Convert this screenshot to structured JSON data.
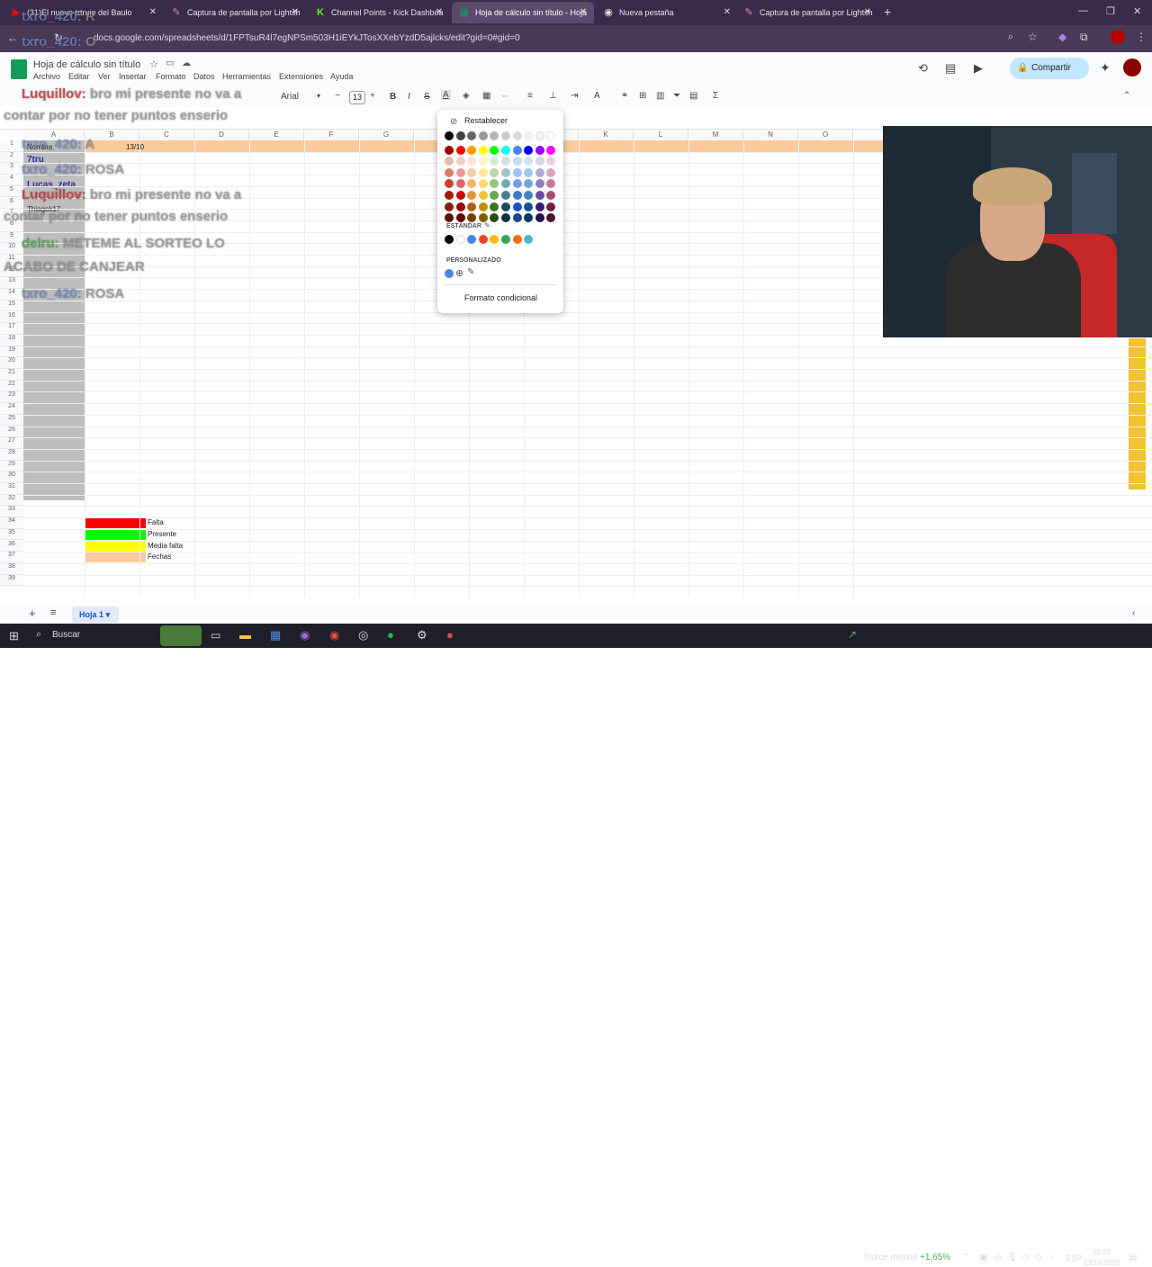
{
  "browser_tabs": [
    {
      "title": "(31)El nuevo trtruie del Baulo",
      "icon": "youtube-icon"
    },
    {
      "title": "Captura de pantalla por Lightsh",
      "icon": "feather-icon"
    },
    {
      "title": "Channel Points - Kick Dashboa",
      "icon": "kick-icon"
    },
    {
      "title": "Hoja de cálculo sin título - Hoja",
      "icon": "sheets-icon",
      "active": true
    },
    {
      "title": "Nueva pestaña",
      "icon": "chrome-icon"
    },
    {
      "title": "Captura de pantalla por Lightsh",
      "icon": "feather-icon"
    }
  ],
  "url": "docs.google.com/spreadsheets/d/1FPTsuR4l7egNPSm503H1iEYkJTosXXebYzdD5ajlcks/edit?gid=0#gid=0",
  "doc": {
    "title": "Hoja de cálculo sin título",
    "share_label": "Compartir"
  },
  "menu": [
    "Archivo",
    "Editar",
    "Ver",
    "Insertar",
    "Formato",
    "Datos",
    "Herramientas",
    "Extensiones",
    "Ayuda"
  ],
  "toolbar": {
    "font": "Arial",
    "font_size": "13"
  },
  "columns": [
    "A",
    "B",
    "C",
    "D",
    "E",
    "F",
    "G",
    "H",
    "I",
    "J",
    "K",
    "L",
    "M",
    "N",
    "O"
  ],
  "cells": {
    "b1": "13/10",
    "a1": "Nombre",
    "a6": "Thiagok17",
    "a5": "Lucas_zeta",
    "a2": "7tru"
  },
  "legend": [
    {
      "label": "Falta",
      "color": "#ff0000"
    },
    {
      "label": "Presente",
      "color": "#00ff00"
    },
    {
      "label": "Media falta",
      "color": "#ffff00"
    },
    {
      "label": "Fechas",
      "color": "#f9cb9c"
    }
  ],
  "palette": {
    "reset_label": "Restablecer",
    "standard_label": "ESTÁNDAR",
    "custom_label": "PERSONALIZADO",
    "cond_label": "Formato condicional"
  },
  "chat": [
    {
      "user": "txro_420:",
      "msg": "R"
    },
    {
      "user": "txro_420:",
      "msg": "O"
    },
    {
      "user": "Luquillov:",
      "msg": "bro mi presente no va a"
    },
    {
      "user": "",
      "msg": "contar por no tener puntos enserio"
    },
    {
      "user": "txro_420:",
      "msg": "A"
    },
    {
      "user": "txro_420:",
      "msg": "ROSA"
    },
    {
      "user": "Luquillov:",
      "msg": "bro mi presente no va a"
    },
    {
      "user": "",
      "msg": "contar por no tener puntos enserio"
    },
    {
      "user": "delru:",
      "msg": "METEME AL SORTEO LO"
    },
    {
      "user": "",
      "msg": "ACABO DE CANJEAR"
    },
    {
      "user": "txro_420:",
      "msg": "ROSA"
    }
  ],
  "sheet_tab": "Hoja 1",
  "taskbar": {
    "search": "Buscar",
    "market": "Índice merval",
    "market_change": "+1,65%",
    "lang": "ESP",
    "time": "15:39",
    "date": "13/10/2025"
  }
}
